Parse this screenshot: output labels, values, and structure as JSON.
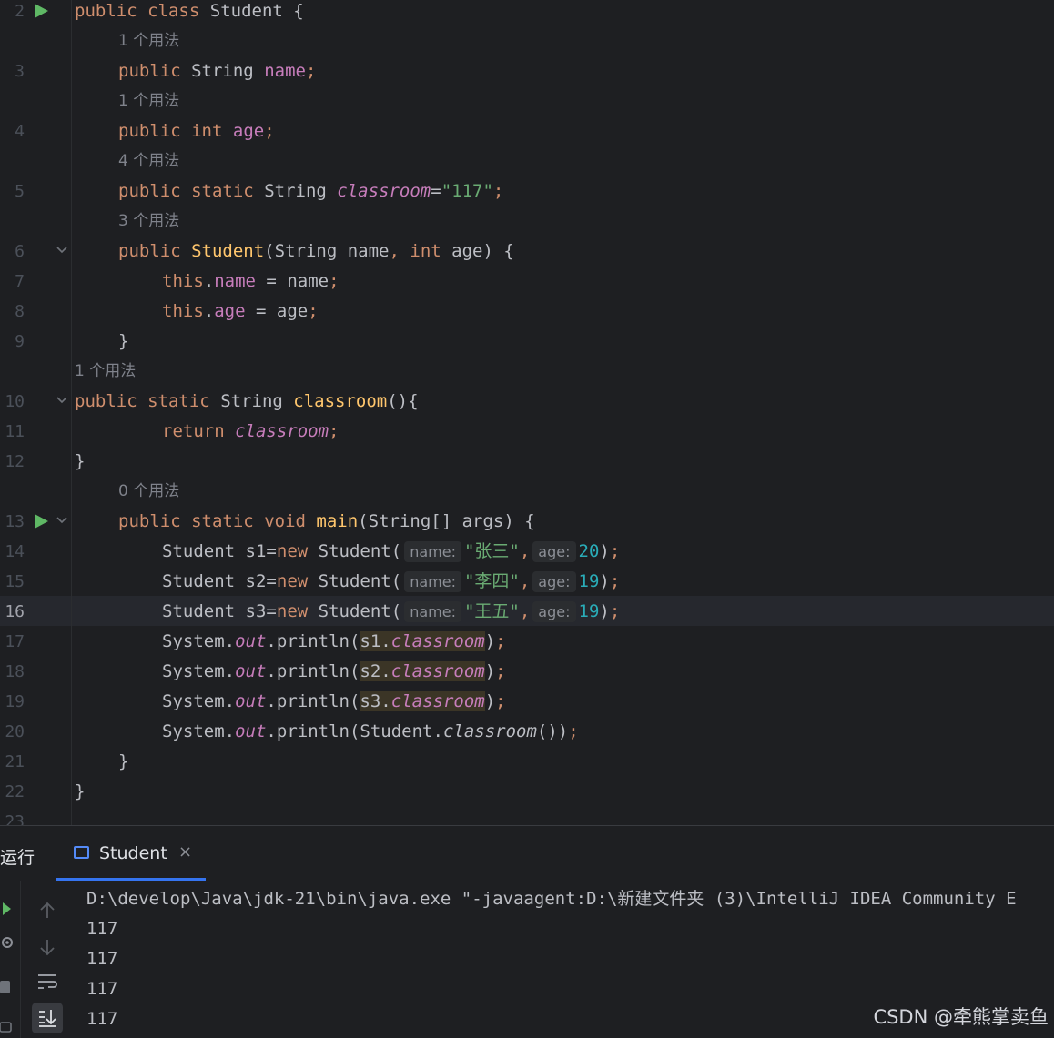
{
  "editor": {
    "lines": [
      {
        "n": "2"
      },
      {
        "n": "3"
      },
      {
        "n": "4"
      },
      {
        "n": "5"
      },
      {
        "n": "6"
      },
      {
        "n": "7"
      },
      {
        "n": "8"
      },
      {
        "n": "9"
      },
      {
        "n": "10"
      },
      {
        "n": "11"
      },
      {
        "n": "12"
      },
      {
        "n": "13"
      },
      {
        "n": "14"
      },
      {
        "n": "15"
      },
      {
        "n": "16"
      },
      {
        "n": "17"
      },
      {
        "n": "18"
      },
      {
        "n": "19"
      },
      {
        "n": "20"
      },
      {
        "n": "21"
      },
      {
        "n": "22"
      },
      {
        "n": "23"
      }
    ],
    "usage_hints": [
      "1 个用法",
      "1 个用法",
      "4 个用法",
      "3 个用法",
      "1 个用法",
      "0 个用法"
    ],
    "t": {
      "public": "public",
      "class": "class",
      "static": "static",
      "int": "int",
      "void": "void",
      "return": "return",
      "this": "this",
      "new": "new",
      "String": "String",
      "Student": "Student",
      "StringArr": "String[]",
      "System": "System",
      "name": "name",
      "age": "age",
      "classroom": "classroom",
      "main": "main",
      "args": "args",
      "out": "out",
      "println": "println",
      "s1": "s1",
      "s2": "s2",
      "s3": "s3",
      "val117": "\"117\"",
      "str_zs": "\"张三\"",
      "str_ls": "\"李四\"",
      "str_ww": "\"王五\"",
      "n20": "20",
      "n19": "19",
      "ph_name": "name:",
      "ph_age": "age:"
    }
  },
  "tool_window": {
    "title": "运行",
    "tab_label": "Student",
    "tab_close": "×",
    "output_lines": [
      "D:\\develop\\Java\\jdk-21\\bin\\java.exe \"-javaagent:D:\\新建文件夹 (3)\\IntelliJ IDEA Community E",
      "117",
      "117",
      "117",
      "117"
    ]
  },
  "watermark": "CSDN @牵熊掌卖鱼",
  "colors": {
    "background": "#1e1f22",
    "keyword": "#cf8e6d",
    "field": "#c77dbb",
    "string": "#6aab73",
    "number": "#2aacb8",
    "method_decl": "#56a8f5",
    "run_gutter": "#5fb865",
    "tab_underline": "#3574f0"
  },
  "icons": [
    "run-gutter-icon",
    "fold-icon",
    "terminal-icon",
    "close-icon",
    "scroll-up-icon",
    "scroll-down-icon",
    "soft-wrap-icon",
    "scroll-to-end-icon",
    "rerun-icon",
    "settings-icon",
    "stop-icon",
    "camera-icon"
  ]
}
